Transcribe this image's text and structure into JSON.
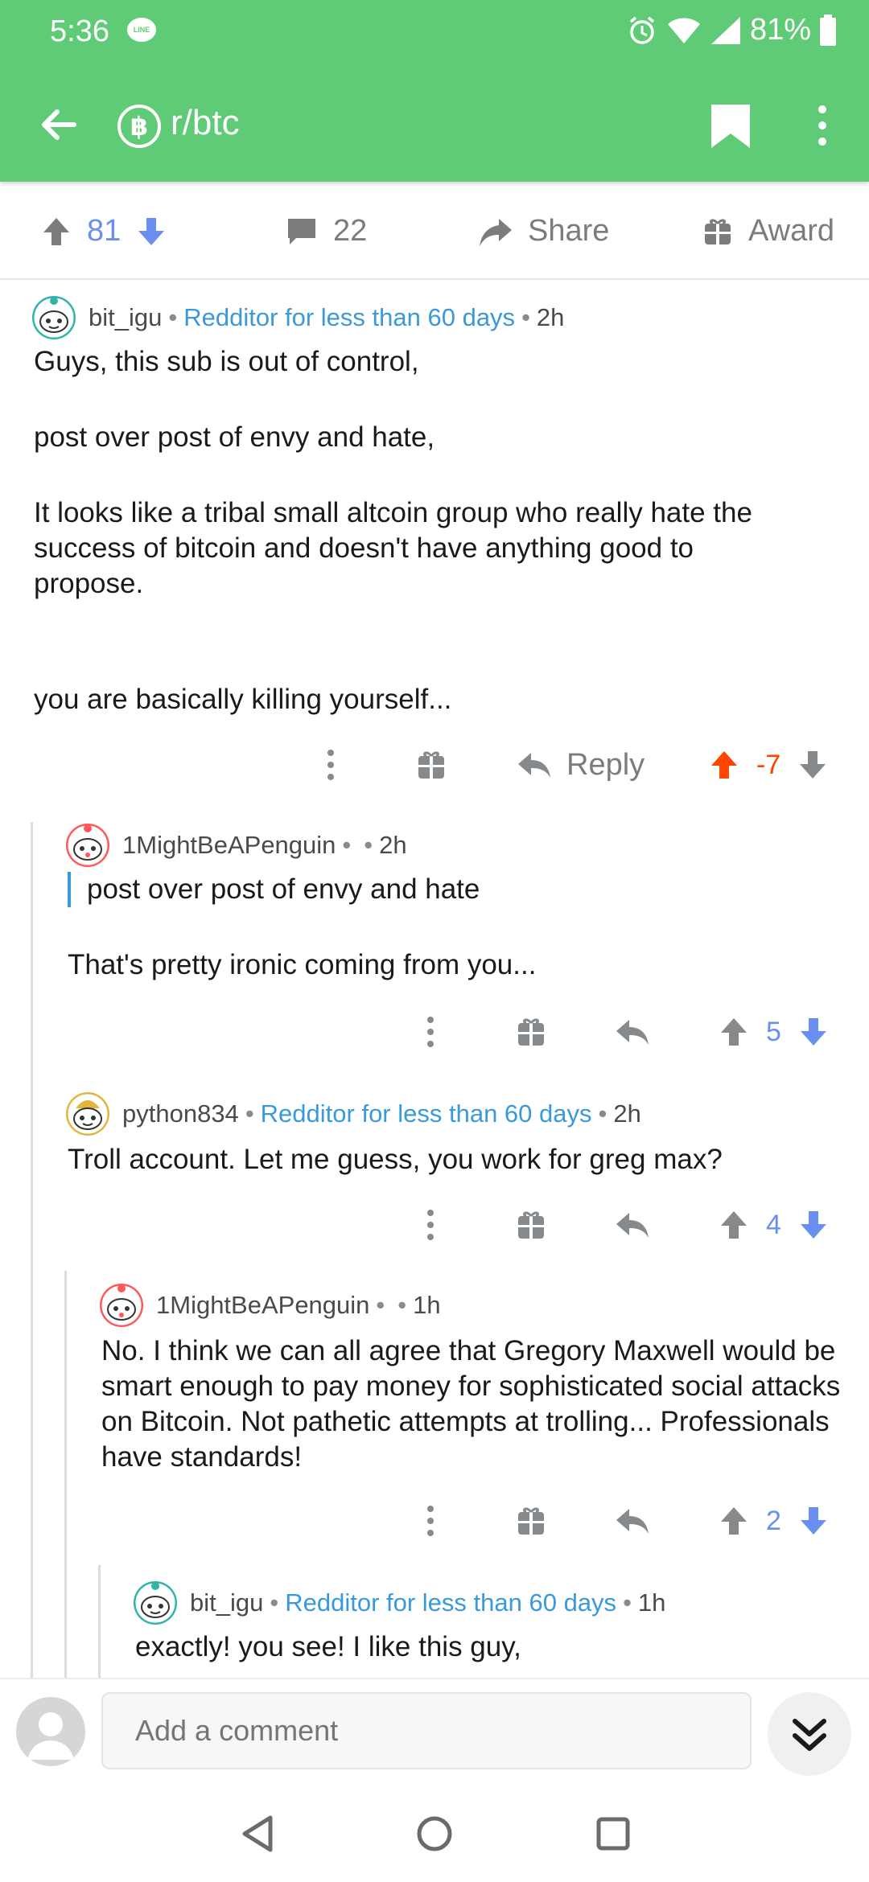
{
  "status": {
    "time": "5:36",
    "line_icon": "LINE",
    "battery": "81%"
  },
  "appbar": {
    "subreddit": "r/btc",
    "subreddit_icon": "฿"
  },
  "post_actions": {
    "upvotes": "81",
    "comments": "22",
    "share": "Share",
    "award": "Award"
  },
  "comments": [
    {
      "author": "bit_igu",
      "flair": "Redditor for less than 60 days",
      "time": "2h",
      "paragraphs": [
        "Guys, this sub is out of control,",
        "post over post of envy and hate,",
        "It looks like a tribal small altcoin group who really hate the success of bitcoin and doesn't have anything good to propose.",
        "you are basically killing yourself..."
      ],
      "reply_label": "Reply",
      "score": "-7"
    },
    {
      "author": "1MightBeAPenguin",
      "flair": "",
      "time": "2h",
      "quote": "post over post of envy and hate",
      "paragraphs": [
        "That's pretty ironic coming from you..."
      ],
      "score": "5"
    },
    {
      "author": "python834",
      "flair": "Redditor for less than 60 days",
      "time": "2h",
      "paragraphs": [
        "Troll account. Let me guess, you work for greg max?"
      ],
      "score": "4"
    },
    {
      "author": "1MightBeAPenguin",
      "flair": "",
      "time": "1h",
      "paragraphs": [
        "No. I think we can all agree that Gregory Maxwell would be smart enough to pay money for sophisticated social attacks on Bitcoin. Not pathetic attempts at trolling... Professionals have standards!"
      ],
      "score": "2"
    },
    {
      "author": "bit_igu",
      "flair": "Redditor for less than 60 days",
      "time": "1h",
      "paragraphs": [
        "exactly! you see! I like this guy,"
      ]
    }
  ],
  "composer": {
    "placeholder": "Add a comment"
  },
  "colors": {
    "header": "#5fcb77",
    "flair": "#3a9ad9",
    "upvote_active": "#ff4500",
    "vote_blue": "#6a8ff0"
  },
  "icons": [
    "back-arrow-icon",
    "bitcoin-icon",
    "bookmark-icon",
    "more-vert-icon",
    "upvote-icon",
    "downvote-icon",
    "comment-icon",
    "share-icon",
    "gift-icon",
    "reply-icon",
    "chevrons-down-icon"
  ]
}
